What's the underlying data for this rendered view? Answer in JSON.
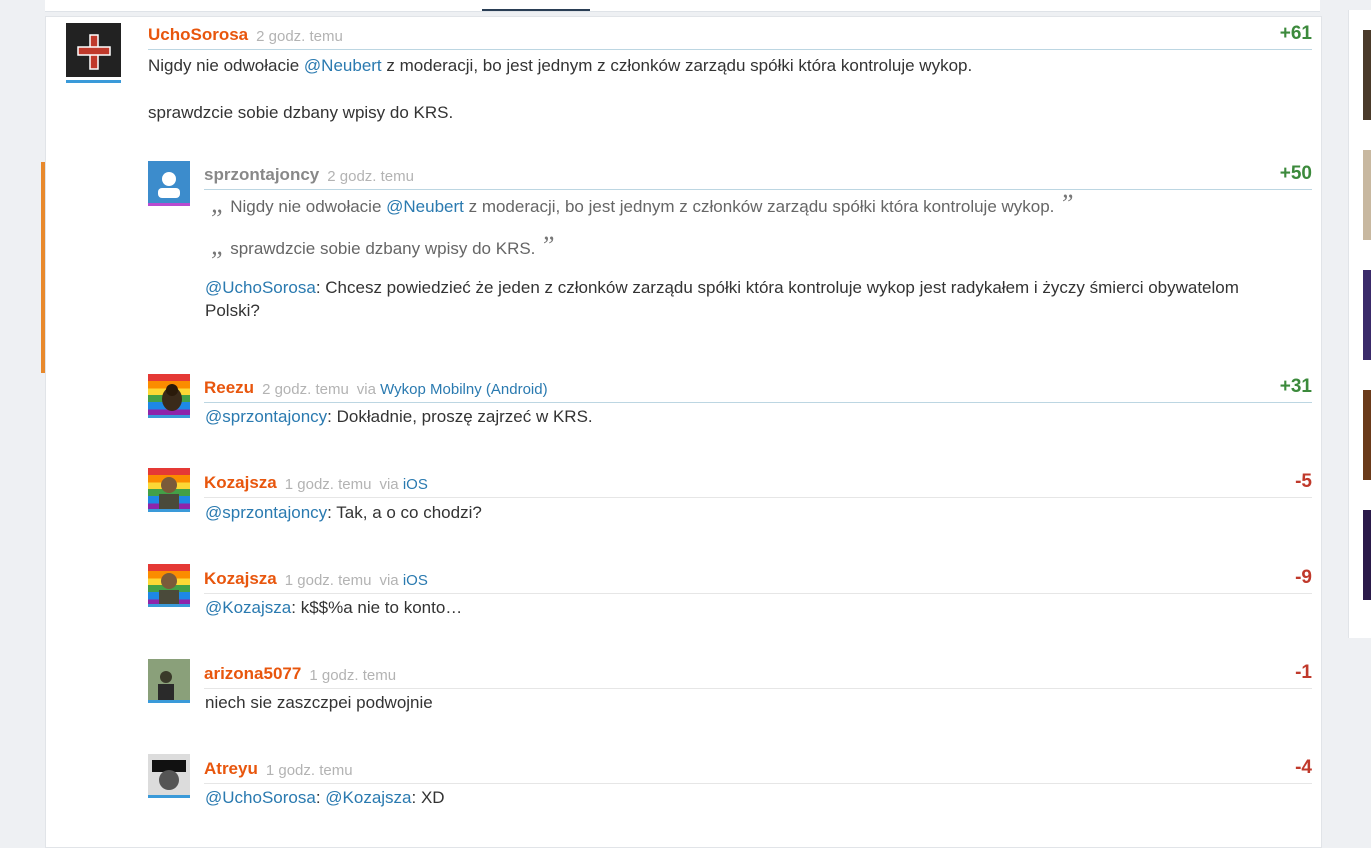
{
  "comments": [
    {
      "author": "UchoSorosa",
      "time": "2 godz. temu",
      "score": "+61",
      "via_label": "",
      "via_link": "",
      "line1_pre": "Nigdy nie odwołacie ",
      "line1_mention": "@Neubert",
      "line1_post": " z moderacji, bo jest jednym z członków zarządu spółki która kontroluje wykop.",
      "line2": "sprawdzcie sobie dzbany wpisy do KRS."
    },
    {
      "author": "sprzontajoncy",
      "time": "2 godz. temu",
      "score": "+50",
      "q1_pre": "Nigdy nie odwołacie ",
      "q1_mention": "@Neubert",
      "q1_post": " z moderacji, bo jest jednym z członków zarządu spółki która kontroluje wykop.",
      "q2": "sprawdzcie sobie dzbany wpisy do KRS.",
      "reply_mention": "@UchoSorosa",
      "reply_text": ": Chcesz powiedzieć że jeden z członków zarządu spółki która kontroluje wykop jest radykałem i życzy śmierci obywatelom",
      "reply_text2": "Polski?"
    },
    {
      "author": "Reezu",
      "time": "2 godz. temu",
      "score": "+31",
      "via_label": "via",
      "via_link": "Wykop Mobilny (Android)",
      "mention": "@sprzontajoncy",
      "text": ": Dokładnie, proszę zajrzeć w KRS."
    },
    {
      "author": "Kozajsza",
      "time": "1 godz. temu",
      "score": "-5",
      "via_label": "via",
      "via_link": "iOS",
      "mention": "@sprzontajoncy",
      "text": ": Tak, a o co chodzi?"
    },
    {
      "author": "Kozajsza",
      "time": "1 godz. temu",
      "score": "-9",
      "via_label": "via",
      "via_link": "iOS",
      "mention": "@Kozajsza",
      "text": ": k$$%a nie to konto…"
    },
    {
      "author": "arizona5077",
      "time": "1 godz. temu",
      "score": "-1",
      "text": "niech sie zaszczpei podwojnie"
    },
    {
      "author": "Atreyu",
      "time": "1 godz. temu",
      "score": "-4",
      "mention": "@UchoSorosa",
      "sep": ": ",
      "mention2": "@Kozajsza",
      "text": ": XD"
    }
  ],
  "colors": {
    "author": "#e8560d",
    "link": "#2a7ab0",
    "positive": "#3c8a3c",
    "negative": "#c0392b",
    "accent": "#e8892c"
  }
}
